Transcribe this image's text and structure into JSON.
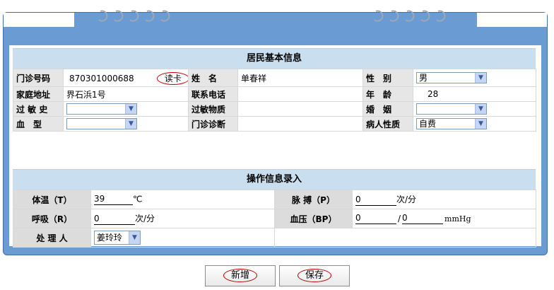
{
  "resident": {
    "title": "居民基本信息",
    "clinic_no_label": "门诊号码",
    "clinic_no_value": "870301000688",
    "read_card_label": "读卡",
    "name_label": "姓　名",
    "name_value": "单春祥",
    "gender_label": "性　别",
    "gender_value": "男",
    "address_label": "家庭地址",
    "address_value": "界石浜1号",
    "phone_label": "联系电话",
    "phone_value": "",
    "age_label": "年　龄",
    "age_value": "28",
    "allergy_history_label": "过 敏 史",
    "allergy_history_value": "",
    "allergen_label": "过敏物质",
    "allergen_value": "",
    "marriage_label": "婚　姻",
    "marriage_value": "",
    "blood_type_label": "血　型",
    "blood_type_value": "",
    "diagnosis_label": "门诊诊断",
    "diagnosis_value": "",
    "patient_type_label": "病人性质",
    "patient_type_value": "自费"
  },
  "operation": {
    "title": "操作信息录入",
    "temp_label": "体温（T）",
    "temp_value": "39",
    "temp_unit": "℃",
    "pulse_label": "脉 搏（P）",
    "pulse_value": "0",
    "pulse_unit": "次/分",
    "resp_label": "呼吸（R）",
    "resp_value": "0",
    "resp_unit": "次/分",
    "bp_label": "血压（BP）",
    "bp_sys_value": "0",
    "bp_sep": "/",
    "bp_dia_value": "0",
    "bp_unit": "mmHg",
    "handler_label": "处 理 人",
    "handler_value": "姜玲玲"
  },
  "buttons": {
    "add_label": "新增",
    "save_label": "保存"
  },
  "icons": {
    "dropdown": "chevron-down-icon",
    "binder": "spiral-binding-icon"
  },
  "colors": {
    "panel": "#6a9bd3",
    "section_header": "#c9deee",
    "label_bg": "#e6e6e6",
    "highlight": "#c00000"
  }
}
